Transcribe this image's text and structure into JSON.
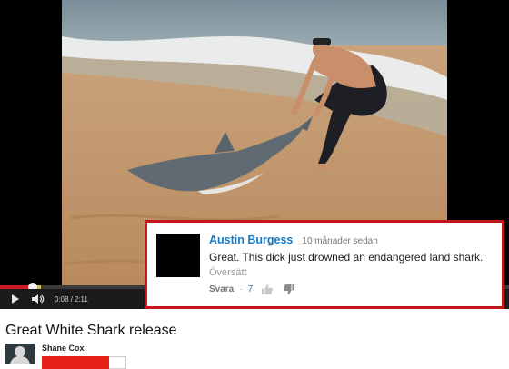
{
  "player": {
    "current_time": "0:08",
    "separator": "/",
    "duration": "2:11",
    "progress_fraction": 0.061,
    "icons": {
      "play": "play-icon",
      "volume": "volume-icon"
    },
    "colors": {
      "played": "#cc181e",
      "buffered": "#cfc24a"
    }
  },
  "comment": {
    "author": "Austin Burgess",
    "time": "10 månader sedan",
    "text": "Great. This dick just drowned an endangered land shark.",
    "translate_label": "Översätt",
    "reply_label": "Svara",
    "separator": "·",
    "like_count": "7",
    "icons": {
      "like": "thumbs-up-icon",
      "dislike": "thumbs-down-icon"
    },
    "border_color": "#c4161c"
  },
  "video": {
    "title": "Great White Shark release",
    "owner": "Shane Cox"
  }
}
